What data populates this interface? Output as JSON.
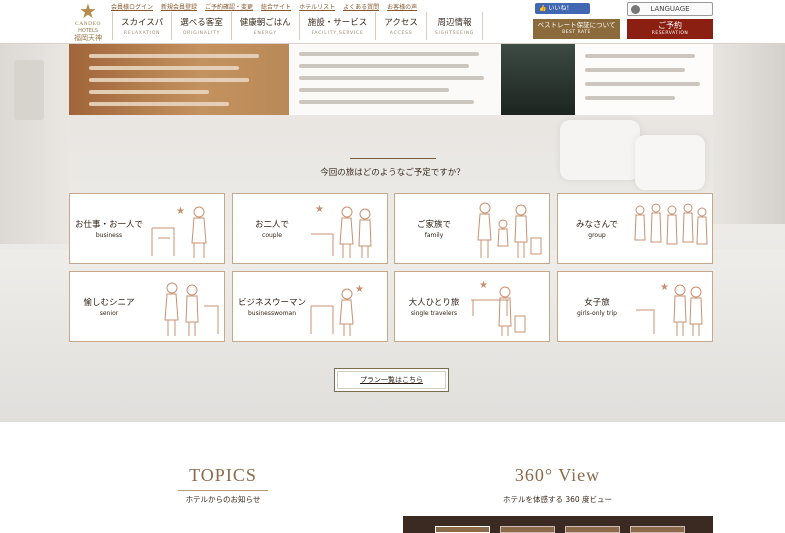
{
  "header": {
    "logo": {
      "brand": "CANDEO",
      "sub": "HOTELS",
      "location": "福岡天神"
    },
    "top_links": [
      "会員様ログイン",
      "新規会員登録",
      "ご予約確認・変更",
      "総合サイト",
      "ホテルリスト",
      "よくある質問",
      "お客様の声"
    ],
    "nav": [
      {
        "jp": "スカイスパ",
        "en": "RELAXATION"
      },
      {
        "jp": "選べる客室",
        "en": "ORIGINALITY"
      },
      {
        "jp": "健康朝ごはん",
        "en": "ENERGY"
      },
      {
        "jp": "施設・サービス",
        "en": "FACILITY,SERVICE"
      },
      {
        "jp": "アクセス",
        "en": "ACCESS"
      },
      {
        "jp": "周辺情報",
        "en": "SIGHTSEEING"
      }
    ],
    "like_label": "いいね！",
    "language_label": "LANGUAGE",
    "best_rate": {
      "jp": "ベストレート保証について",
      "en": "BEST RATE"
    },
    "reserve": {
      "jp": "ご予約",
      "en": "RESERVATION"
    }
  },
  "question": "今回の旅はどのようなご予定ですか？",
  "categories": [
    {
      "jp": "お仕事・お一人で",
      "en": "business"
    },
    {
      "jp": "お二人で",
      "en": "couple"
    },
    {
      "jp": "ご家族で",
      "en": "family"
    },
    {
      "jp": "みなさんで",
      "en": "group"
    },
    {
      "jp": "愉しむシニア",
      "en": "senior"
    },
    {
      "jp": "ビジネスウーマン",
      "en": "businesswoman"
    },
    {
      "jp": "大人ひとり旅",
      "en": "single travelers"
    },
    {
      "jp": "女子旅",
      "en": "girls-only trip"
    }
  ],
  "plan_button": "プラン一覧はこちら",
  "topics": {
    "title": "TOPICS",
    "subtitle": "ホテルからのお知らせ"
  },
  "view360": {
    "title": "360° View",
    "subtitle": "ホテルを体感する 360 度ビュー"
  },
  "colors": {
    "brand_gold": "#8b6a3b",
    "reserve_red": "#8a1f12",
    "card_border": "#c9a88a"
  }
}
